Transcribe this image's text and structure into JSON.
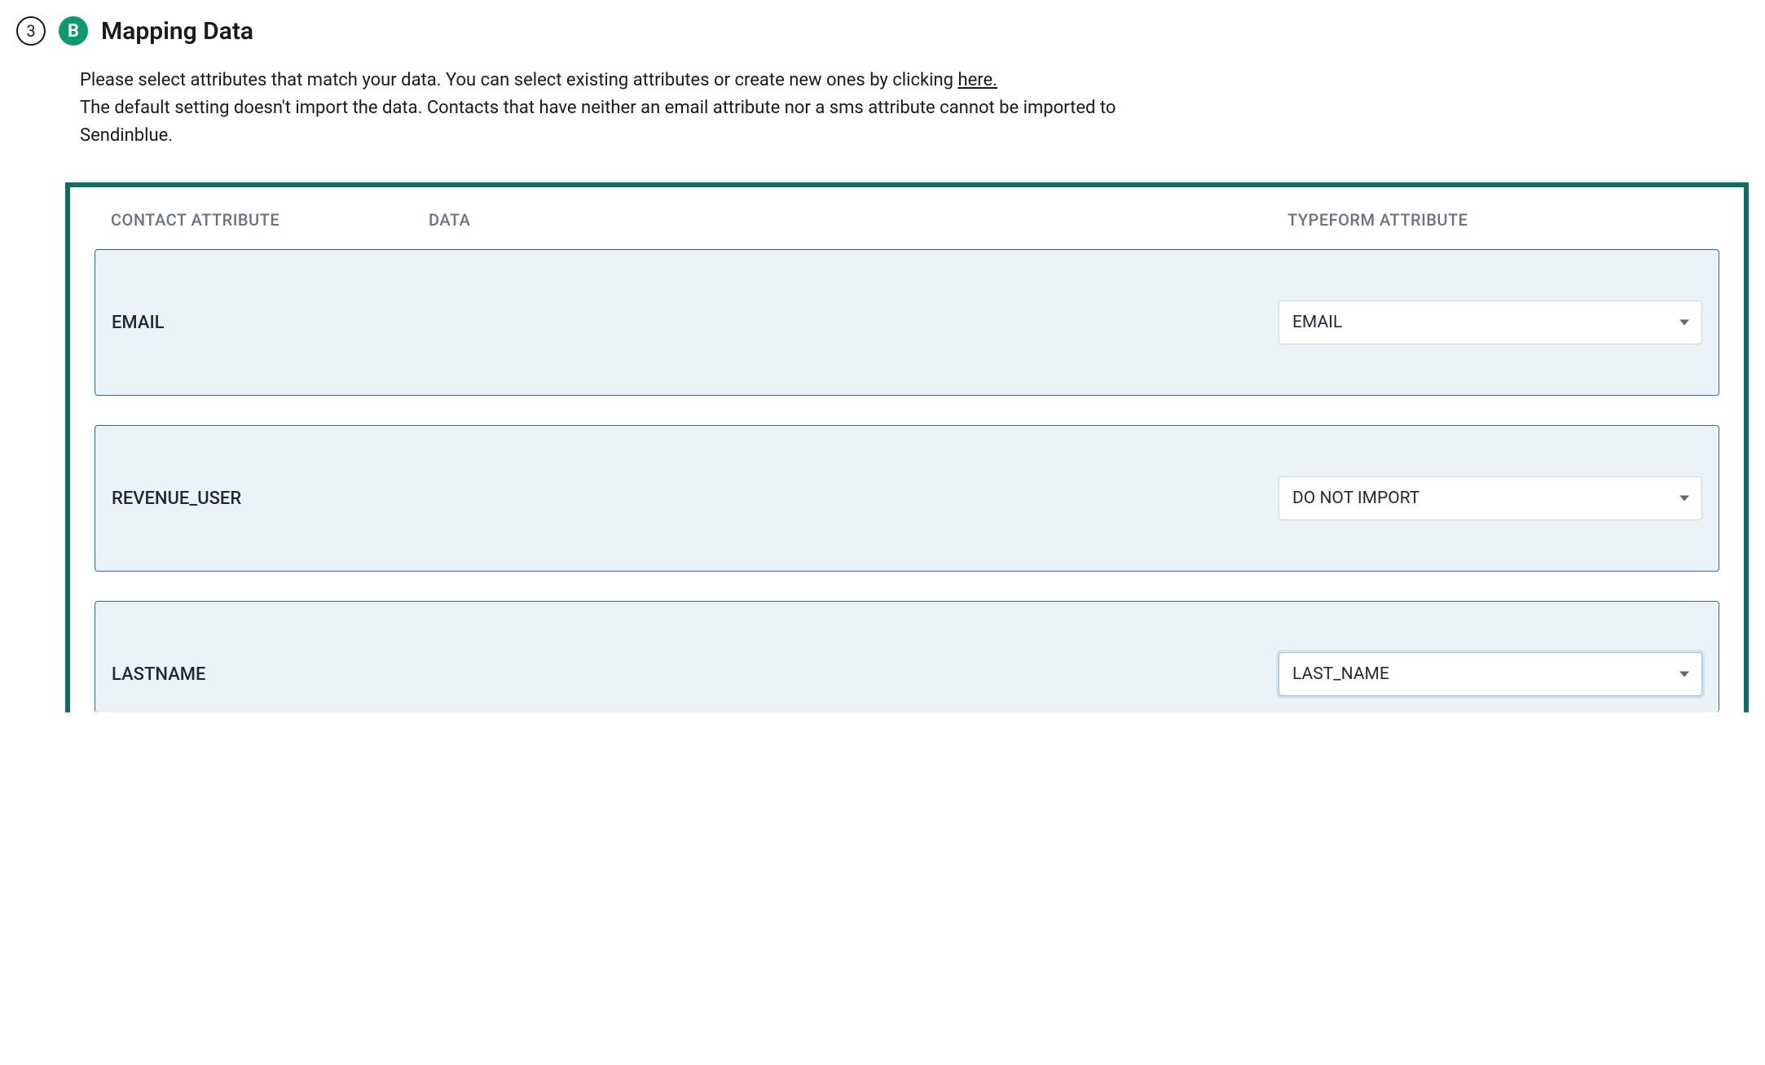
{
  "step": {
    "number": "3",
    "brand_letter": "B",
    "title": "Mapping Data"
  },
  "description": {
    "line1_prefix": "Please select attributes that match your data. You can select existing attributes or create new ones by clicking ",
    "link_text": "here.",
    "line2": "The default setting doesn't import the data. Contacts that have neither an email attribute nor a sms attribute cannot be imported to Sendinblue."
  },
  "columns": {
    "contact": "CONTACT ATTRIBUTE",
    "data": "DATA",
    "typeform": "TYPEFORM ATTRIBUTE"
  },
  "rows": [
    {
      "contact": "EMAIL",
      "selected": "EMAIL",
      "active": false
    },
    {
      "contact": "REVENUE_USER",
      "selected": "DO NOT IMPORT",
      "active": false
    },
    {
      "contact": "LASTNAME",
      "selected": "LAST_NAME",
      "active": true
    }
  ]
}
